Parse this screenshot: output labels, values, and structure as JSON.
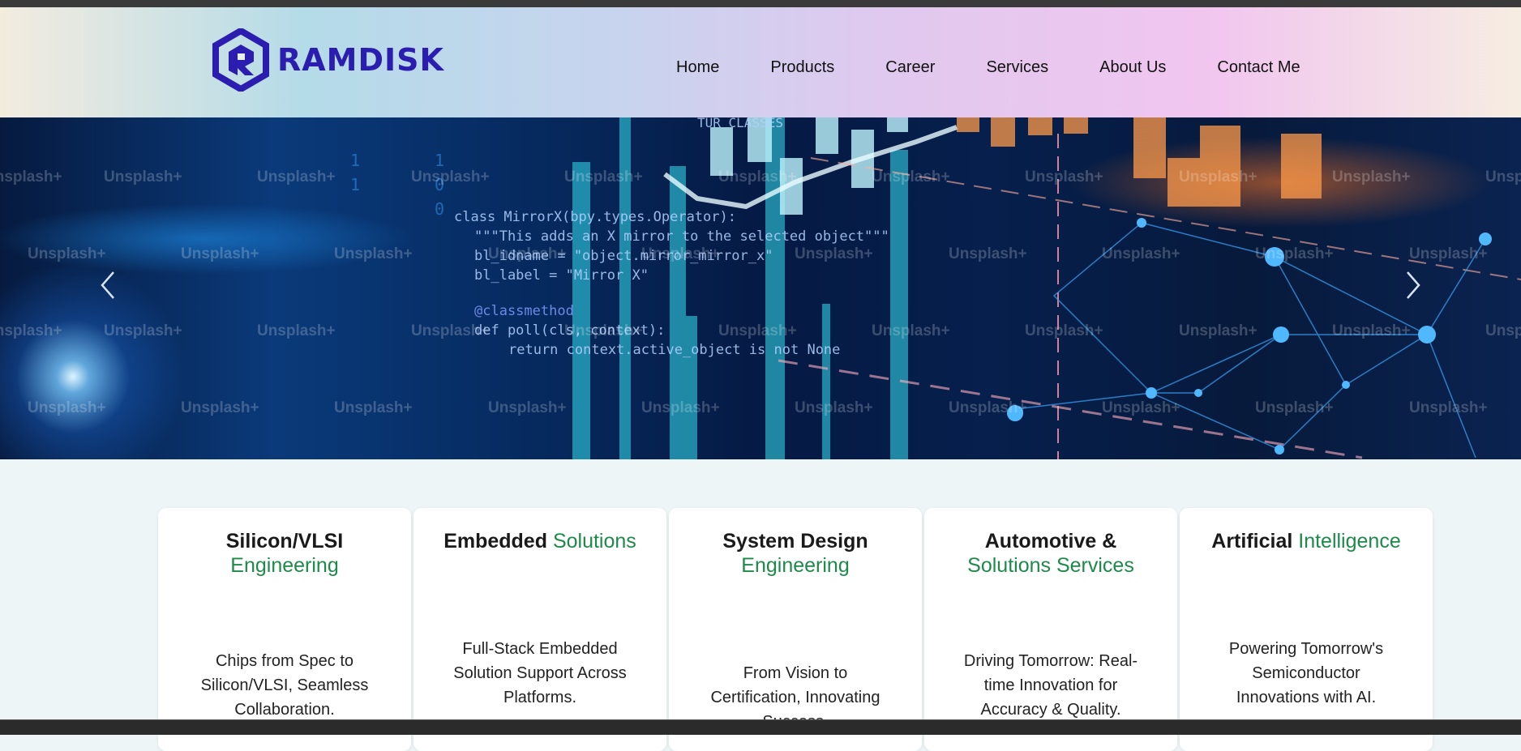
{
  "brand": {
    "name": "RAMDISK",
    "color": "#2a1db0"
  },
  "nav": {
    "items": [
      "Home",
      "Products",
      "Career",
      "Services",
      "About Us",
      "Contact Me"
    ]
  },
  "hero": {
    "watermark": "Unsplash+",
    "code_lines": [
      "class MirrorX(bpy.types.Operator):",
      "\"\"\"This adds an X mirror to the selected object\"\"\"",
      "bl_idname = \"object.mirror_mirror_x\"",
      "bl_label = \"Mirror X\"",
      "@classmethod",
      "def poll(cls, context):",
      "return context.active_object is not None"
    ],
    "banner_text": "TUR CLASSES"
  },
  "cards": [
    {
      "title": "Silicon/VLSI",
      "accent": "Engineering",
      "split": true,
      "description": "Chips from Spec to Silicon/VLSI, Seamless Collaboration."
    },
    {
      "title": "Embedded",
      "accent": "Solutions",
      "split": false,
      "description": "Full-Stack Embedded Solution Support Across Platforms."
    },
    {
      "title": "System Design",
      "accent": "Engineering",
      "split": true,
      "description": "From Vision to Certification, Innovating Success."
    },
    {
      "title": "Automotive &",
      "accent": "Solutions Services",
      "split": true,
      "description": "Driving Tomorrow: Real-time Innovation for Accuracy & Quality."
    },
    {
      "title": "Artificial",
      "accent": "Intelligence",
      "split": false,
      "description": "Powering Tomorrow's Semiconductor Innovations with AI."
    }
  ],
  "colors": {
    "accent_green": "#1e8a4a"
  }
}
